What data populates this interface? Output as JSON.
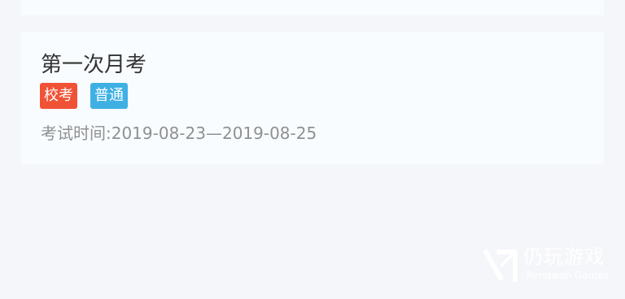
{
  "exam": {
    "title": "第一次月考",
    "tags": [
      "校考",
      "普通"
    ],
    "time_text": "考试时间:2019-08-23—2019-08-25"
  },
  "watermark": {
    "name": "仍玩游戏",
    "subtitle": "Rengwan Games"
  },
  "colors": {
    "tag_school": "#f05236",
    "tag_normal": "#3fb0e3",
    "background": "#f5f6fa",
    "card": "#f8fcff"
  }
}
